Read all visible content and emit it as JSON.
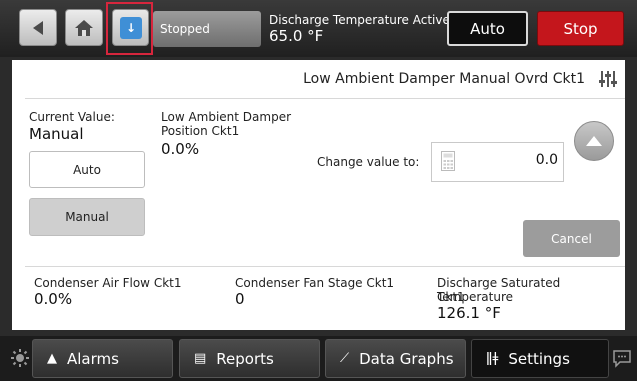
{
  "topbar": {
    "status_text": "Stopped",
    "discharge_label": "Discharge Temperature Active",
    "discharge_value": "65.0 °F",
    "auto_label": "Auto",
    "stop_label": "Stop",
    "info_glyph": "↓"
  },
  "panel": {
    "title": "Low Ambient Damper Manual Ovrd Ckt1",
    "current_value_label": "Current Value:",
    "current_value": "Manual",
    "position_label_1": "Low Ambient Damper",
    "position_label_2": "Position Ckt1",
    "position_value": "0.0%",
    "auto_button": "Auto",
    "manual_button": "Manual",
    "change_label": "Change value to:",
    "input_value": "0.0",
    "cancel_button": "Cancel"
  },
  "stats": {
    "airflow_label": "Condenser Air Flow Ckt1",
    "airflow_value": "0.0%",
    "fan_stage_label": "Condenser Fan Stage Ckt1",
    "fan_stage_value": "0",
    "sat_temp_label_1": "Discharge Saturated Temperature",
    "sat_temp_label_2": "Ckt1",
    "sat_temp_value": "126.1 °F"
  },
  "nav": {
    "alarms": "Alarms",
    "reports": "Reports",
    "graphs": "Data Graphs",
    "settings": "Settings"
  },
  "colors": {
    "stop": "#c4161c",
    "info_accent": "#3f8fd6",
    "highlight_border": "#d7263d"
  }
}
